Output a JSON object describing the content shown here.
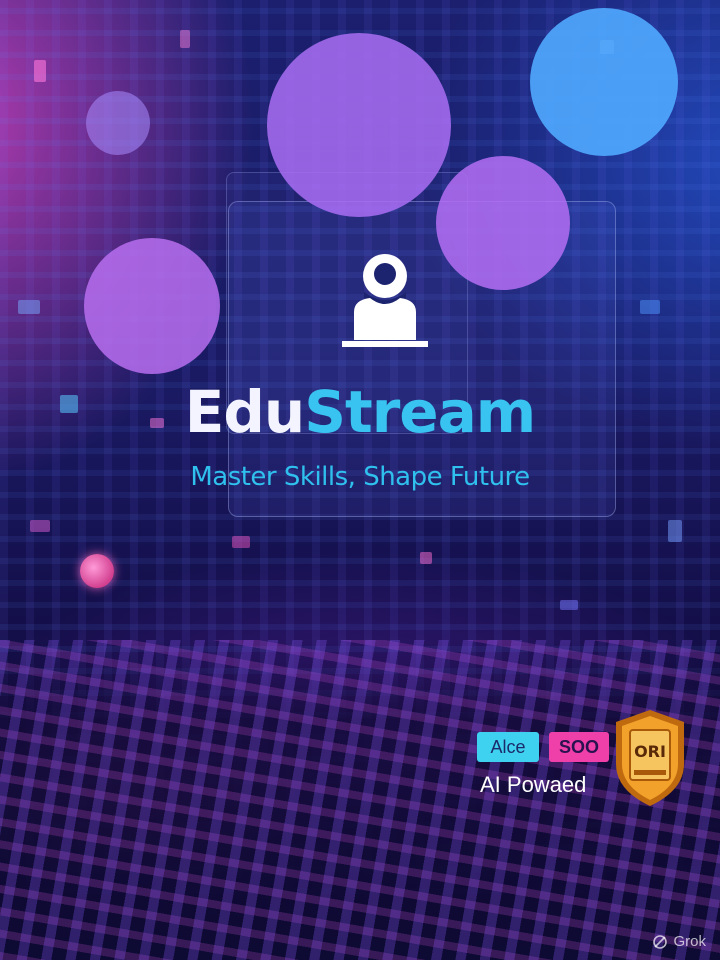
{
  "title": {
    "part1": "Edu",
    "part2": "Stream"
  },
  "tagline": "Master Skills, Shape Future",
  "tags": {
    "left": "Alce",
    "right": "SOO"
  },
  "ai_label": "AI Powaed",
  "badge_text": "ORI",
  "watermark": "Grok",
  "colors": {
    "title_primary": "#f3f4ff",
    "title_accent": "#38c3f0",
    "tagline": "#2fc0ee",
    "tag_left_bg": "#3fd2f0",
    "tag_right_bg": "#ef3fa8",
    "badge": "#f2a12a"
  },
  "icons": [
    "user-profile-icon",
    "shield-badge-icon",
    "grok-logo-icon"
  ]
}
